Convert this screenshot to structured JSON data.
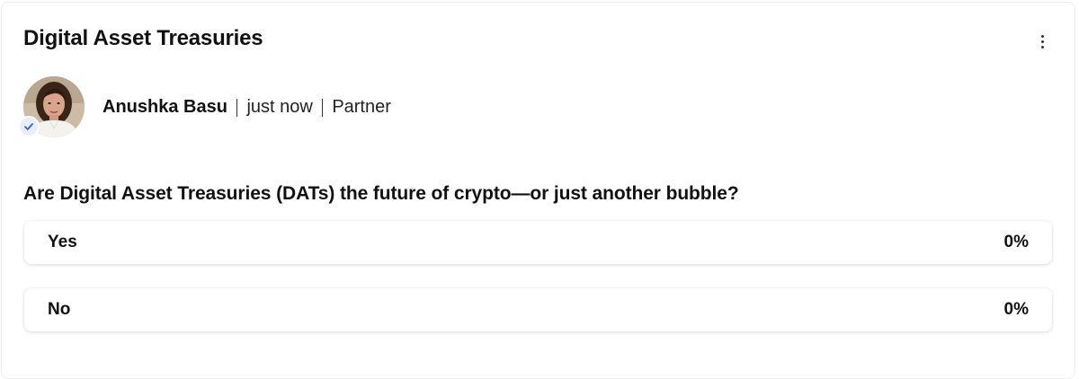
{
  "post": {
    "title": "Digital Asset Treasuries",
    "more_icon": "more-vertical-icon"
  },
  "author": {
    "name": "Anushka Basu",
    "time": "just now",
    "role": "Partner",
    "verified_icon": "check-icon",
    "verified_color": "#3b5bdb"
  },
  "poll": {
    "question": "Are Digital Asset Treasuries (DATs) the future of crypto—or just another bubble?",
    "options": [
      {
        "label": "Yes",
        "percent_label": "0%",
        "percent": 0
      },
      {
        "label": "No",
        "percent_label": "0%",
        "percent": 0
      }
    ]
  }
}
